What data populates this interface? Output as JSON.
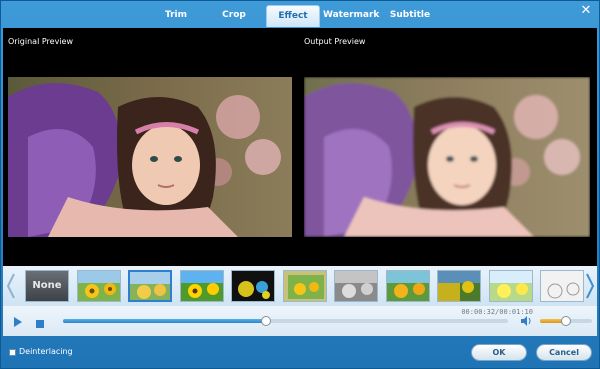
{
  "tabs": [
    {
      "label": "Trim",
      "active": false
    },
    {
      "label": "Crop",
      "active": false
    },
    {
      "label": "Effect",
      "active": true
    },
    {
      "label": "Watermark",
      "active": false
    },
    {
      "label": "Subtitle",
      "active": false
    }
  ],
  "close_icon": "close-icon",
  "preview": {
    "original_label": "Original Preview",
    "output_label": "Output Preview"
  },
  "effects": {
    "none_label": "None",
    "selected_index": 2,
    "thumbnails": [
      {
        "name": "effect-none"
      },
      {
        "name": "effect-normal"
      },
      {
        "name": "effect-blur"
      },
      {
        "name": "effect-vivid"
      },
      {
        "name": "effect-dark"
      },
      {
        "name": "effect-frame"
      },
      {
        "name": "effect-grayscale"
      },
      {
        "name": "effect-warm"
      },
      {
        "name": "effect-mosaic"
      },
      {
        "name": "effect-bright"
      },
      {
        "name": "effect-sketch"
      }
    ]
  },
  "player": {
    "time": "00:00:32/00:01:10",
    "progress_fraction": 0.457,
    "volume_fraction": 0.5
  },
  "footer": {
    "deinterlacing_label": "Deinterlacing",
    "deinterlacing_checked": false,
    "ok_label": "OK",
    "cancel_label": "Cancel"
  },
  "colors": {
    "accent": "#1f74b6",
    "tab_active_text": "#1e6fb2",
    "volume": "#d8961b"
  }
}
